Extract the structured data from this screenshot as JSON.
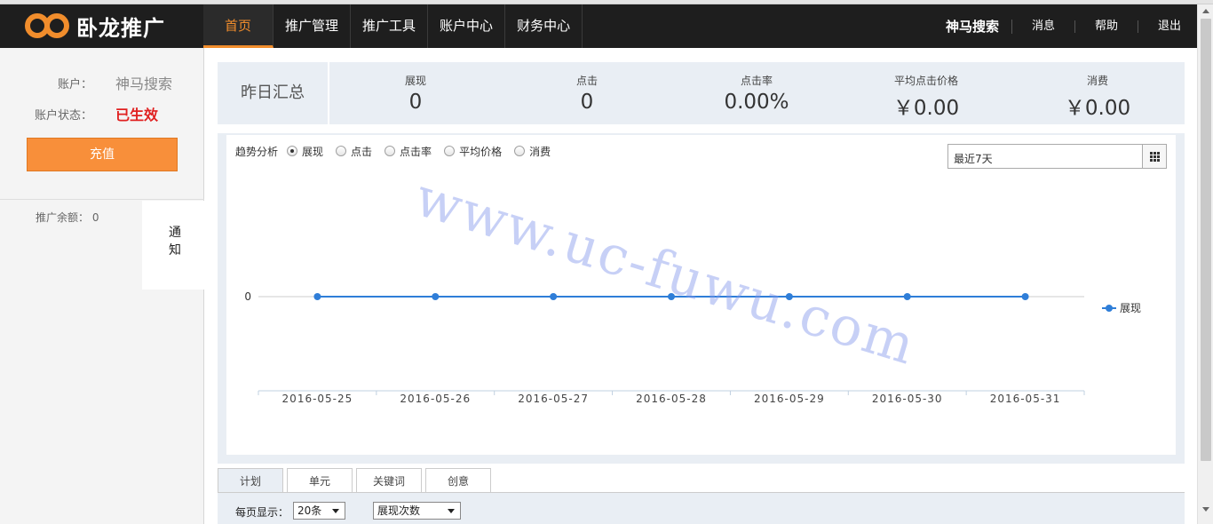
{
  "app": {
    "logo_text": "卧龙推广"
  },
  "nav": {
    "items": [
      {
        "label": "首页",
        "active": true
      },
      {
        "label": "推广管理",
        "active": false
      },
      {
        "label": "推广工具",
        "active": false
      },
      {
        "label": "账户中心",
        "active": false
      },
      {
        "label": "财务中心",
        "active": false
      }
    ]
  },
  "header_right": {
    "brand": "神马搜索",
    "links": [
      "消息",
      "帮助",
      "退出"
    ]
  },
  "sidebar": {
    "account_label": "账户：",
    "account_value": "神马搜索",
    "status_label": "账户状态：",
    "status_value": "已生效",
    "recharge_label": "充值",
    "balance_text": "推广余额： 0",
    "notice_text": "通知"
  },
  "summary": {
    "title": "昨日汇总",
    "stats": [
      {
        "label": "展现",
        "value": "0"
      },
      {
        "label": "点击",
        "value": "0"
      },
      {
        "label": "点击率",
        "value": "0.00%"
      },
      {
        "label": "平均点击价格",
        "value": "￥0.00"
      },
      {
        "label": "消费",
        "value": "￥0.00"
      }
    ]
  },
  "trend": {
    "label": "趋势分析",
    "options": [
      {
        "label": "展现",
        "checked": true
      },
      {
        "label": "点击",
        "checked": false
      },
      {
        "label": "点击率",
        "checked": false
      },
      {
        "label": "平均价格",
        "checked": false
      },
      {
        "label": "消费",
        "checked": false
      }
    ],
    "range_value": "最近7天"
  },
  "watermark": "www.uc-fuwu.com",
  "chart_data": {
    "type": "line",
    "x": [
      "2016-05-25",
      "2016-05-26",
      "2016-05-27",
      "2016-05-28",
      "2016-05-29",
      "2016-05-30",
      "2016-05-31"
    ],
    "series": [
      {
        "name": "展现",
        "values": [
          0,
          0,
          0,
          0,
          0,
          0,
          0
        ],
        "color": "#2f7ed8"
      }
    ],
    "yticks": [
      "0"
    ],
    "legend_position": "right",
    "grid": false
  },
  "tabs": [
    "计划",
    "单元",
    "关键词",
    "创意"
  ],
  "table_controls": {
    "per_page_label": "每页显示：",
    "per_page_value": "20条",
    "sort_value": "展现次数"
  },
  "colors": {
    "accent": "#f18d2c",
    "header_bg": "#1e1e1e",
    "status_red": "#e02020",
    "panel_bg": "#e9eef4",
    "line": "#2f7ed8"
  }
}
